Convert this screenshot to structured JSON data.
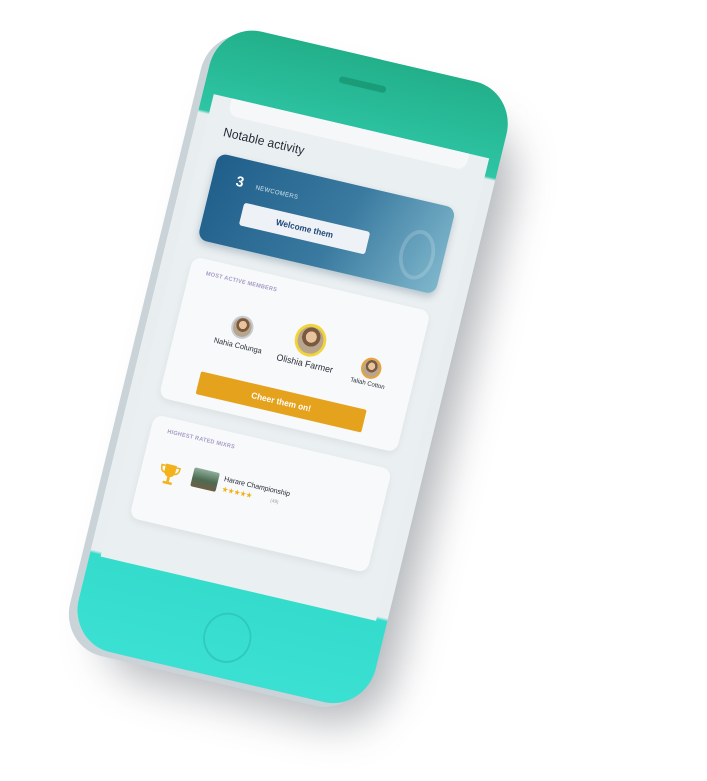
{
  "notable_activity": {
    "title": "Notable activity",
    "newcomers": {
      "count": "3",
      "label": "NEWCOMERS",
      "button_label": "Welcome them"
    },
    "most_active": {
      "caption": "MOST ACTIVE MEMBERS",
      "members": [
        {
          "name": "Nahia Colunga"
        },
        {
          "name": "Olishia Farmer"
        },
        {
          "name": "Taliah Cotton"
        }
      ],
      "button_label": "Cheer them on!"
    },
    "highest_rated": {
      "caption": "HIGHEST RATED MIXRS",
      "items": [
        {
          "title": "Harare Championship",
          "stars": "★★★★★",
          "rating_count": "(49)"
        }
      ]
    }
  },
  "colors": {
    "brand_teal": "#2ec5a5",
    "newcomers_blue": "#1f5e8a",
    "cheer_gold": "#e5a21d",
    "caption_lavender": "#a59cc8",
    "star_gold": "#f2b21c"
  },
  "icons": [
    "trophy-icon",
    "star-icon"
  ]
}
